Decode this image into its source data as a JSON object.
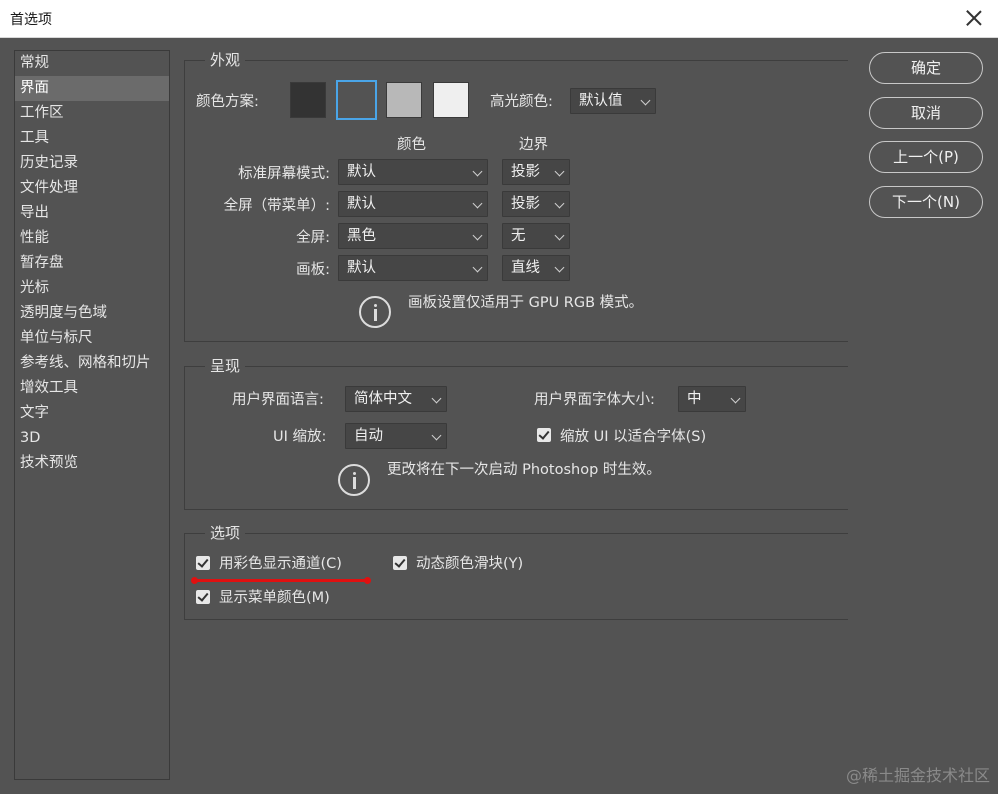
{
  "window": {
    "title": "首选项"
  },
  "sidebar": {
    "items": [
      {
        "label": "常规"
      },
      {
        "label": "界面"
      },
      {
        "label": "工作区"
      },
      {
        "label": "工具"
      },
      {
        "label": "历史记录"
      },
      {
        "label": "文件处理"
      },
      {
        "label": "导出"
      },
      {
        "label": "性能"
      },
      {
        "label": "暂存盘"
      },
      {
        "label": "光标"
      },
      {
        "label": "透明度与色域"
      },
      {
        "label": "单位与标尺"
      },
      {
        "label": "参考线、网格和切片"
      },
      {
        "label": "增效工具"
      },
      {
        "label": "文字"
      },
      {
        "label": "3D"
      },
      {
        "label": "技术预览"
      }
    ],
    "selected": "界面"
  },
  "appearance": {
    "legend": "外观",
    "color_scheme_label": "颜色方案:",
    "swatches": [
      "#333333",
      "#535353",
      "#b8b8b8",
      "#efefef"
    ],
    "selected_swatch": 1,
    "highlight_label": "高光颜色:",
    "highlight_value": "默认值",
    "col_color": "颜色",
    "col_border": "边界",
    "rows": [
      {
        "label": "标准屏幕模式:",
        "color": "默认",
        "border": "投影"
      },
      {
        "label": "全屏（带菜单）:",
        "color": "默认",
        "border": "投影"
      },
      {
        "label": "全屏:",
        "color": "黑色",
        "border": "无"
      },
      {
        "label": "画板:",
        "color": "默认",
        "border": "直线"
      }
    ],
    "note": "画板设置仅适用于 GPU RGB 模式。"
  },
  "presentation": {
    "legend": "呈现",
    "ui_language_label": "用户界面语言:",
    "ui_language_value": "简体中文",
    "ui_font_size_label": "用户界面字体大小:",
    "ui_font_size_value": "中",
    "ui_scale_label": "UI 缩放:",
    "ui_scale_value": "自动",
    "scale_checkbox_label": "缩放 UI 以适合字体(S)",
    "note": "更改将在下一次启动 Photoshop 时生效。"
  },
  "options": {
    "legend": "选项",
    "color_channels_label": "用彩色显示通道(C)",
    "dynamic_sliders_label": "动态颜色滑块(Y)",
    "menu_colors_label": "显示菜单颜色(M)"
  },
  "buttons": {
    "ok": "确定",
    "cancel": "取消",
    "prev": "上一个(P)",
    "next": "下一个(N)"
  },
  "watermark": "@稀土掘金技术社区"
}
